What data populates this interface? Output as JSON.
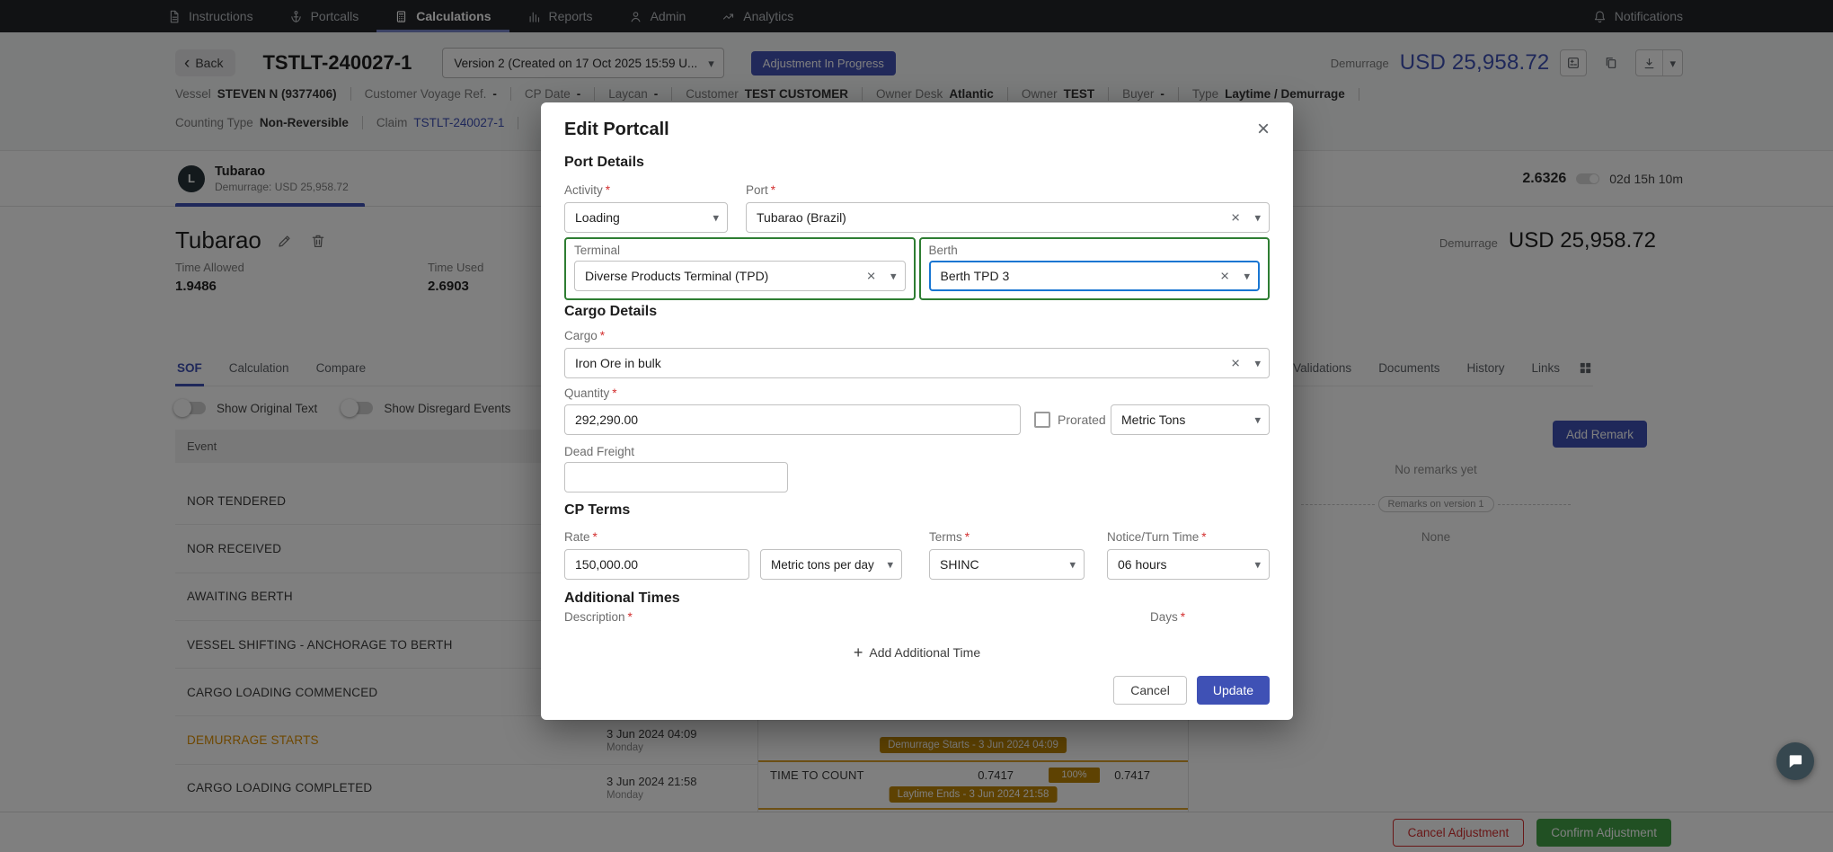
{
  "colors": {
    "accent_indigo": "#3f51b5",
    "focus_blue": "#1976d2",
    "highlight_green": "#2e7d32",
    "confirm_green": "#43a047",
    "cancel_red": "#d32f2f",
    "badge_orange": "#bd8505",
    "demurrage_text_orange": "#dd8f00",
    "nav_background": "#222429"
  },
  "icons": {
    "caret_down": "▾",
    "close": "×",
    "clear": "×",
    "back_chevron": "‹",
    "plus": "+"
  },
  "nav": {
    "items": [
      {
        "label": "Instructions"
      },
      {
        "label": "Portcalls"
      },
      {
        "label": "Calculations"
      },
      {
        "label": "Reports"
      },
      {
        "label": "Admin"
      },
      {
        "label": "Analytics"
      }
    ],
    "notifications": "Notifications"
  },
  "header": {
    "back": "Back",
    "title": "TSTLT-240027-1",
    "version": "Version 2 (Created on 17 Oct 2025 15:59 U...",
    "adjustment_status": "Adjustment In Progress",
    "demurrage_label": "Demurrage",
    "demurrage_value": "USD 25,958.72",
    "meta": [
      {
        "label": "Vessel",
        "value": "STEVEN N (9377406)"
      },
      {
        "label": "Customer Voyage Ref.",
        "value": "-"
      },
      {
        "label": "CP Date",
        "value": "-"
      },
      {
        "label": "Laycan",
        "value": "-"
      },
      {
        "label": "Customer",
        "value": "TEST CUSTOMER"
      },
      {
        "label": "Owner Desk",
        "value": "Atlantic"
      },
      {
        "label": "Owner",
        "value": "TEST"
      },
      {
        "label": "Buyer",
        "value": "-"
      },
      {
        "label": "Type",
        "value": "Laytime / Demurrage"
      }
    ],
    "meta2": [
      {
        "label": "Counting Type",
        "value": "Non-Reversible"
      },
      {
        "label": "Claim",
        "value": "TSTLT-240027-1"
      }
    ]
  },
  "portcall_tab": {
    "initial": "L",
    "name": "Tubarao",
    "subtitle": "Demurrage: USD 25,958.72",
    "factor": "2.6326",
    "duration": "02d 15h 10m"
  },
  "portcall": {
    "name": "Tubarao",
    "time_allowed_label": "Time Allowed",
    "time_allowed": "1.9486",
    "time_used_label": "Time Used",
    "time_used": "2.6903",
    "demurrage_label": "Demurrage",
    "demurrage_value": "USD 25,958.72"
  },
  "tabs": {
    "left": [
      {
        "label": "SOF"
      },
      {
        "label": "Calculation"
      },
      {
        "label": "Compare"
      }
    ],
    "right": [
      {
        "label": "Validations"
      },
      {
        "label": "Documents"
      },
      {
        "label": "History"
      },
      {
        "label": "Links"
      }
    ]
  },
  "toggles": [
    {
      "label": "Show Original Text"
    },
    {
      "label": "Show Disregard Events"
    }
  ],
  "sof": {
    "event_header": "Event",
    "events": [
      {
        "name": "NOR TENDERED"
      },
      {
        "name": "NOR RECEIVED"
      },
      {
        "name": "AWAITING BERTH"
      },
      {
        "name": "VESSEL SHIFTING - ANCHORAGE TO BERTH"
      },
      {
        "name": "CARGO LOADING COMMENCED"
      },
      {
        "name": "DEMURRAGE STARTS",
        "date": "3 Jun 2024 04:09",
        "day": "Monday"
      },
      {
        "name": "CARGO LOADING COMPLETED",
        "date": "3 Jun 2024 21:58",
        "day": "Monday"
      }
    ],
    "timeline": {
      "start_badge": "Demurrage Starts - 3 Jun 2024 04:09",
      "row_label": "TIME TO COUNT",
      "value_a": "0.7417",
      "percent": "100%",
      "value_b": "0.7417",
      "end_badge": "Laytime Ends - 3 Jun 2024 21:58"
    }
  },
  "remarks": {
    "add_button": "Add Remark",
    "empty": "No remarks yet",
    "divider": "Remarks on version 1",
    "none": "None"
  },
  "footer": {
    "cancel": "Cancel Adjustment",
    "confirm": "Confirm Adjustment"
  },
  "modal": {
    "title": "Edit Portcall",
    "req": "*",
    "port_details": "Port Details",
    "activity_label": "Activity",
    "activity_value": "Loading",
    "port_label": "Port",
    "port_value": "Tubarao (Brazil)",
    "terminal_label": "Terminal",
    "terminal_value": "Diverse Products Terminal (TPD)",
    "berth_label": "Berth",
    "berth_value": "Berth TPD 3",
    "cargo_details": "Cargo Details",
    "cargo_label": "Cargo",
    "cargo_value": "Iron Ore in bulk",
    "quantity_label": "Quantity",
    "quantity_value": "292,290.00",
    "prorated_label": "Prorated",
    "quantity_unit": "Metric Tons",
    "dead_freight_label": "Dead Freight",
    "cp_terms": "CP Terms",
    "rate_label": "Rate",
    "rate_value": "150,000.00",
    "rate_unit": "Metric tons per day",
    "terms_label": "Terms",
    "terms_value": "SHINC",
    "notice_label": "Notice/Turn Time",
    "notice_value": "06 hours",
    "additional_times": "Additional Times",
    "description_label": "Description",
    "days_label": "Days",
    "add_additional_time": "Add Additional Time",
    "cancel": "Cancel",
    "update": "Update"
  }
}
